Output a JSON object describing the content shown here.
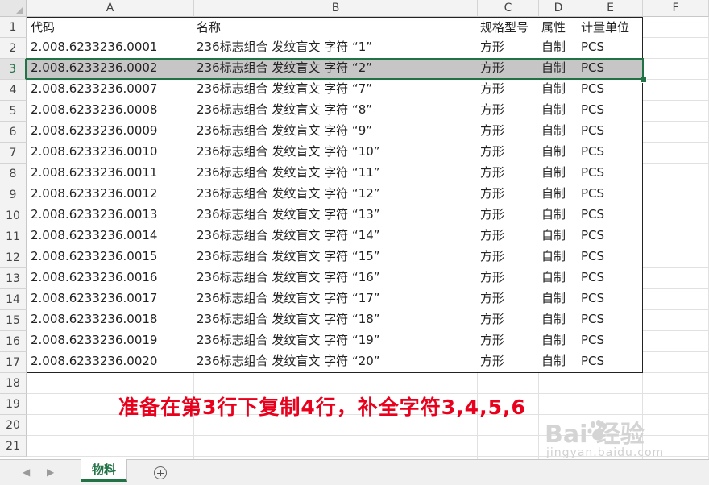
{
  "columns": [
    "A",
    "B",
    "C",
    "D",
    "E",
    "F"
  ],
  "row_numbers": [
    "1",
    "2",
    "3",
    "4",
    "5",
    "6",
    "7",
    "8",
    "9",
    "10",
    "11",
    "12",
    "13",
    "14",
    "15",
    "16",
    "17",
    "18",
    "19",
    "20",
    "21"
  ],
  "selected_row": "3",
  "table": {
    "headers": [
      "代码",
      "名称",
      "规格型号",
      "属性",
      "计量单位"
    ],
    "rows": [
      [
        "2.008.6233236.0001",
        "236标志组合 发纹盲文 字符 “1”",
        "方形",
        "自制",
        "PCS"
      ],
      [
        "2.008.6233236.0002",
        "236标志组合 发纹盲文 字符 “2”",
        "方形",
        "自制",
        "PCS"
      ],
      [
        "2.008.6233236.0007",
        "236标志组合 发纹盲文 字符 “7”",
        "方形",
        "自制",
        "PCS"
      ],
      [
        "2.008.6233236.0008",
        "236标志组合 发纹盲文 字符 “8”",
        "方形",
        "自制",
        "PCS"
      ],
      [
        "2.008.6233236.0009",
        "236标志组合 发纹盲文 字符 “9”",
        "方形",
        "自制",
        "PCS"
      ],
      [
        "2.008.6233236.0010",
        "236标志组合 发纹盲文 字符 “10”",
        "方形",
        "自制",
        "PCS"
      ],
      [
        "2.008.6233236.0011",
        "236标志组合 发纹盲文 字符 “11”",
        "方形",
        "自制",
        "PCS"
      ],
      [
        "2.008.6233236.0012",
        "236标志组合 发纹盲文 字符 “12”",
        "方形",
        "自制",
        "PCS"
      ],
      [
        "2.008.6233236.0013",
        "236标志组合 发纹盲文 字符 “13”",
        "方形",
        "自制",
        "PCS"
      ],
      [
        "2.008.6233236.0014",
        "236标志组合 发纹盲文 字符 “14”",
        "方形",
        "自制",
        "PCS"
      ],
      [
        "2.008.6233236.0015",
        "236标志组合 发纹盲文 字符 “15”",
        "方形",
        "自制",
        "PCS"
      ],
      [
        "2.008.6233236.0016",
        "236标志组合 发纹盲文 字符 “16”",
        "方形",
        "自制",
        "PCS"
      ],
      [
        "2.008.6233236.0017",
        "236标志组合 发纹盲文 字符 “17”",
        "方形",
        "自制",
        "PCS"
      ],
      [
        "2.008.6233236.0018",
        "236标志组合 发纹盲文 字符 “18”",
        "方形",
        "自制",
        "PCS"
      ],
      [
        "2.008.6233236.0019",
        "236标志组合 发纹盲文 字符 “19”",
        "方形",
        "自制",
        "PCS"
      ],
      [
        "2.008.6233236.0020",
        "236标志组合 发纹盲文 字符 “20”",
        "方形",
        "自制",
        "PCS"
      ]
    ]
  },
  "annotation": "准备在第3行下复制4行，补全字符3,4,5,6",
  "watermark": {
    "brand": "Bai  经验",
    "url": "jingyan.baidu.com"
  },
  "sheet_tabs": [
    {
      "label": "物料",
      "active": true
    }
  ],
  "icons": {
    "prev_sheet": "chevron-left-icon",
    "next_sheet": "chevron-right-icon",
    "add_sheet": "plus-circle-icon"
  },
  "colors": {
    "accent": "#217346",
    "annotation": "#e8001c",
    "row_highlight": "#c6c6c6"
  }
}
